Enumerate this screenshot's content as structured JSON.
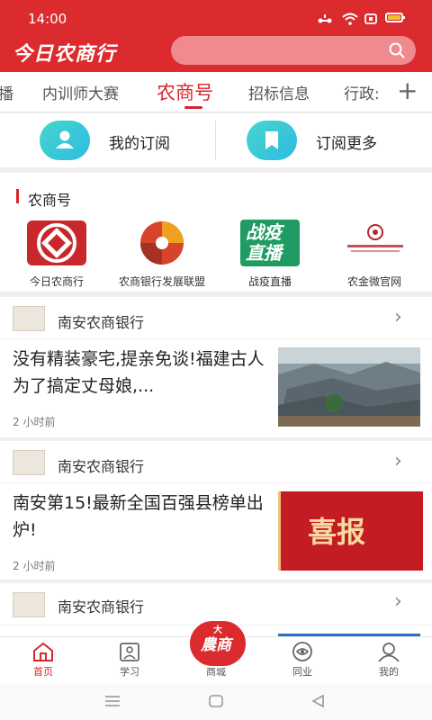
{
  "status_bar": {
    "time": "14:00"
  },
  "header": {
    "logo": "今日农商行"
  },
  "tabs": [
    {
      "label": "播"
    },
    {
      "label": "内训师大赛"
    },
    {
      "label": "农商号"
    },
    {
      "label": "招标信息"
    },
    {
      "label": "行政:"
    }
  ],
  "subscribe": {
    "my_label": "我的订阅",
    "more_label": "订阅更多"
  },
  "section": {
    "title": "农商号",
    "brands": [
      {
        "label": "今日农商行"
      },
      {
        "label": "农商银行发展联盟"
      },
      {
        "label": "战疫直播",
        "logo_text_top": "战疫",
        "logo_text_bottom": "直播"
      },
      {
        "label": "农金微官网"
      }
    ]
  },
  "feed": [
    {
      "source": "南安农商银行",
      "title": "没有精装豪宅,提亲免谈!福建古人为了搞定丈母娘,...",
      "time": "2 小时前"
    },
    {
      "source": "南安农商银行",
      "title": "南安第15!最新全国百强县榜单出炉!",
      "time": "2 小时前",
      "thumb_text": "喜报"
    },
    {
      "source": "南安农商银行"
    }
  ],
  "mall_badge": {
    "top": "大",
    "main": "農商"
  },
  "nav": [
    {
      "label": "首页"
    },
    {
      "label": "学习"
    },
    {
      "label": "商城"
    },
    {
      "label": "同业"
    },
    {
      "label": "我的"
    }
  ],
  "colors": {
    "brand_red": "#dc2b2e",
    "accent_teal": "#2dbbe2"
  }
}
